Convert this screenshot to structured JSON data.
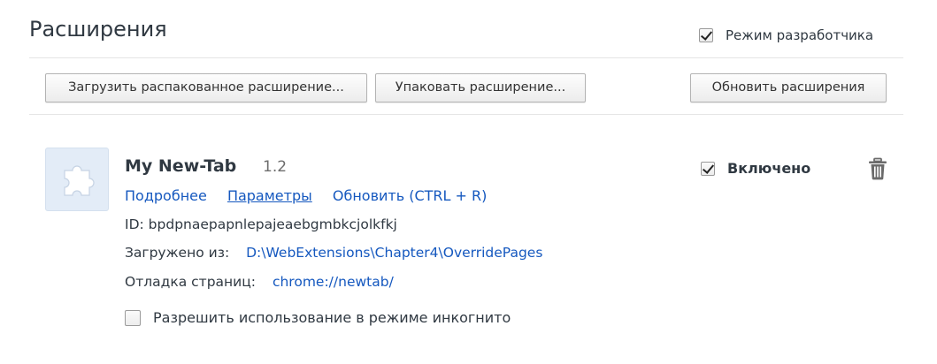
{
  "page": {
    "title": "Расширения"
  },
  "developer_mode": {
    "label": "Режим разработчика",
    "checked": true
  },
  "toolbar": {
    "load_unpacked_label": "Загрузить распакованное расширение...",
    "pack_label": "Упаковать расширение...",
    "update_label": "Обновить расширения"
  },
  "extension": {
    "icon": "puzzle-piece-icon",
    "name": "My New-Tab",
    "version": "1.2",
    "links": {
      "details": "Подробнее",
      "options": "Параметры",
      "reload": "Обновить (CTRL + R)"
    },
    "id_label": "ID:",
    "id_value": "bpdpnaepapnlepajeaebgmbkcjolkfkj",
    "loaded_from_label": "Загружено из:",
    "loaded_from_path": "D:\\WebExtensions\\Chapter4\\OverridePages",
    "inspect_label": "Отладка страниц:",
    "inspect_view": "chrome://newtab/",
    "incognito_label": "Разрешить использование в режиме инкогнито",
    "incognito_checked": false,
    "enabled_label": "Включено",
    "enabled_checked": true,
    "remove_icon": "trash-icon"
  },
  "colors": {
    "link": "#1558bf",
    "text": "#303942",
    "icon_bg": "#e3ecf7"
  }
}
